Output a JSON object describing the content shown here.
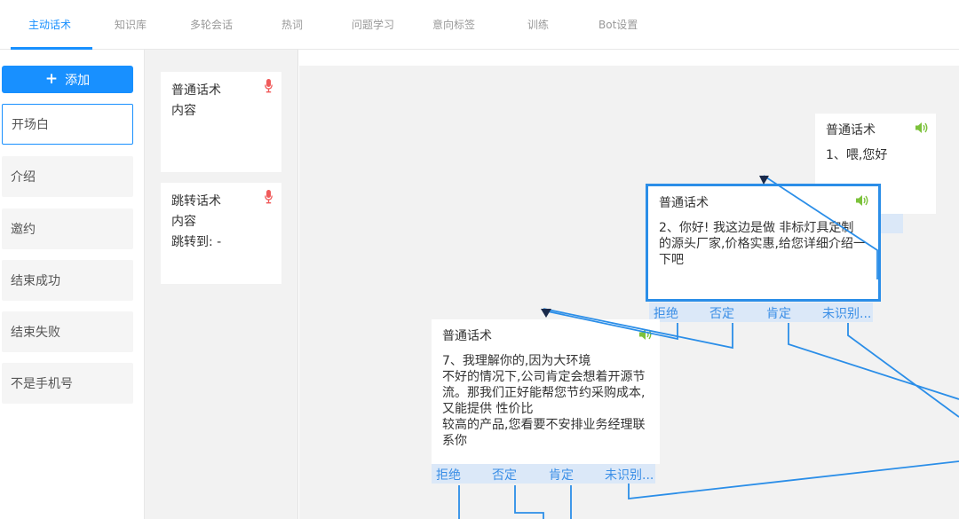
{
  "tabs": [
    {
      "label": "主动话术",
      "active": true
    },
    {
      "label": "知识库"
    },
    {
      "label": "多轮会话"
    },
    {
      "label": "热词"
    },
    {
      "label": "问题学习"
    },
    {
      "label": "意向标签"
    },
    {
      "label": "训练"
    },
    {
      "label": "Bot设置"
    }
  ],
  "sidebar": {
    "add_label": "添加",
    "categories": [
      "开场白",
      "介绍",
      "邀约",
      "结束成功",
      "结束失败",
      "不是手机号"
    ]
  },
  "templates": [
    {
      "title": "普通话术",
      "lines": [
        "内容"
      ]
    },
    {
      "title": "跳转话术",
      "lines": [
        "内容",
        "跳转到: -"
      ]
    }
  ],
  "nodes": {
    "n1": {
      "title": "普通话术",
      "content": "1、喂,您好"
    },
    "n2": {
      "title": "普通话术",
      "content": "2、你好!  我这边是做 非标灯具定制\n的源头厂家,价格实惠,给您详细介绍一下吧"
    },
    "n7": {
      "title": "普通话术",
      "content": "7、我理解你的,因为大环境\n不好的情况下,公司肯定会想着开源节流。那我们正好能帮您节约采购成本,又能提供 性价比\n较高的产品,您看要不安排业务经理联系你"
    }
  },
  "branches": [
    "拒绝",
    "否定",
    "肯定",
    "未识别..."
  ],
  "colors": {
    "accent": "#1890ff",
    "link": "#2b8ee8",
    "mic": "#f05a5a",
    "speaker": "#7cc23b"
  }
}
